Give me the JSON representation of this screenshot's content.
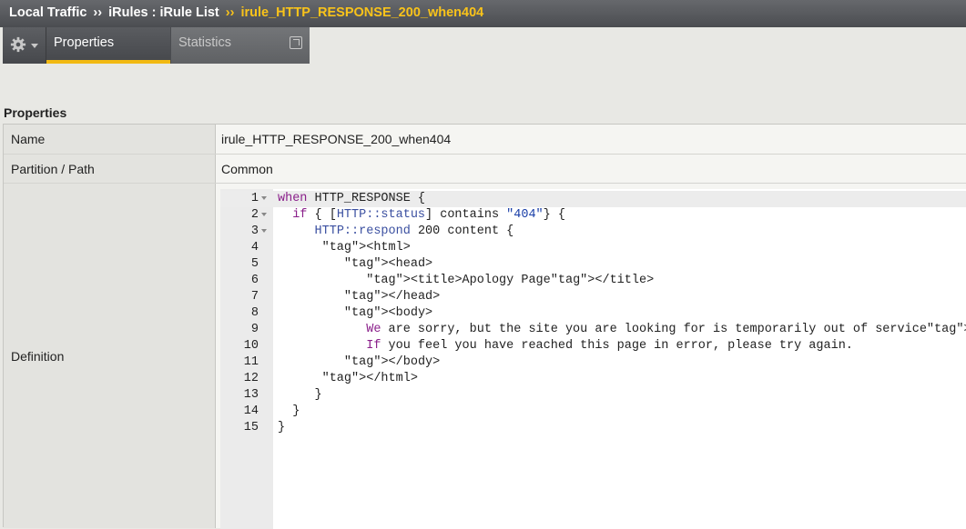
{
  "breadcrumb": {
    "items": [
      "Local Traffic",
      "iRules : iRule List"
    ],
    "separator": "››",
    "current": "irule_HTTP_RESPONSE_200_when404"
  },
  "tabs": [
    {
      "label": "Properties",
      "active": true
    },
    {
      "label": "Statistics",
      "active": false
    }
  ],
  "section_title": "Properties",
  "properties": {
    "name_label": "Name",
    "name_value": "irule_HTTP_RESPONSE_200_when404",
    "partition_label": "Partition / Path",
    "partition_value": "Common",
    "definition_label": "Definition"
  },
  "code_lines": [
    {
      "n": "1",
      "fold": true,
      "active": true,
      "text": "when HTTP_RESPONSE {"
    },
    {
      "n": "2",
      "fold": true,
      "active": false,
      "text": "  if { [HTTP::status] contains \"404\"} {"
    },
    {
      "n": "3",
      "fold": true,
      "active": false,
      "text": "     HTTP::respond 200 content {"
    },
    {
      "n": "4",
      "fold": false,
      "active": false,
      "text": "      <html>"
    },
    {
      "n": "5",
      "fold": false,
      "active": false,
      "text": "         <head>"
    },
    {
      "n": "6",
      "fold": false,
      "active": false,
      "text": "            <title>Apology Page</title>"
    },
    {
      "n": "7",
      "fold": false,
      "active": false,
      "text": "         </head>"
    },
    {
      "n": "8",
      "fold": false,
      "active": false,
      "text": "         <body>"
    },
    {
      "n": "9",
      "fold": false,
      "active": false,
      "text": "            We are sorry, but the site you are looking for is temporarily out of service<br>"
    },
    {
      "n": "10",
      "fold": false,
      "active": false,
      "text": "            If you feel you have reached this page in error, please try again."
    },
    {
      "n": "11",
      "fold": false,
      "active": false,
      "text": "         </body>"
    },
    {
      "n": "12",
      "fold": false,
      "active": false,
      "text": "      </html>"
    },
    {
      "n": "13",
      "fold": false,
      "active": false,
      "text": "     }"
    },
    {
      "n": "14",
      "fold": false,
      "active": false,
      "text": "  }"
    },
    {
      "n": "15",
      "fold": false,
      "active": false,
      "text": "}"
    }
  ],
  "colors": {
    "breadcrumb_current": "#f9c31a",
    "tab_active_underline": "#f2b912",
    "keyword": "#8a1f8a",
    "string": "#1a3fa8"
  },
  "icons": {
    "menu": "gear-icon",
    "popout": "popout-icon"
  }
}
